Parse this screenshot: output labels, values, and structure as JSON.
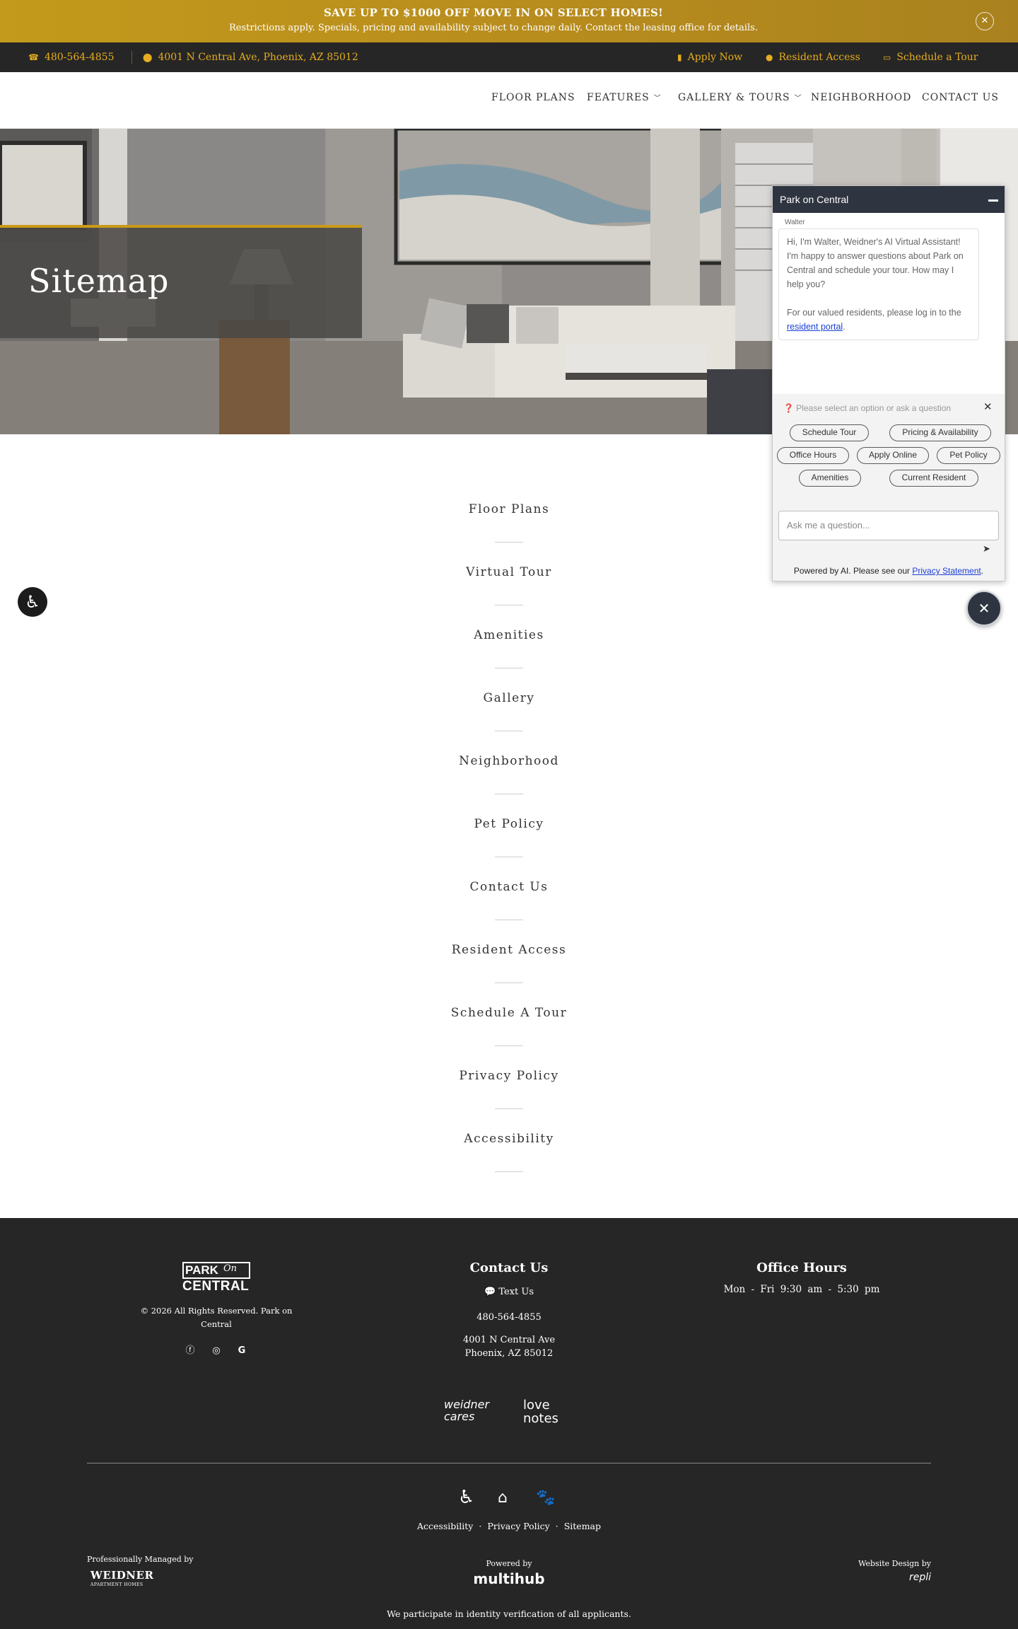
{
  "promo": {
    "headline": "SAVE UP TO $1000 OFF MOVE IN ON SELECT HOMES!",
    "subtext": "Restrictions apply. Specials, pricing and availability subject to change daily. Contact the leasing office for details.",
    "close_glyph": "✕"
  },
  "utility": {
    "phone": "480-564-4855",
    "address": "4001 N Central Ave, Phoenix, AZ 85012",
    "apply": "Apply Now",
    "resident": "Resident Access",
    "tour": "Schedule a Tour",
    "accent_color": "#e6ad1f"
  },
  "nav": {
    "items": [
      {
        "label": "FLOOR PLANS"
      },
      {
        "label": "FEATURES"
      },
      {
        "label": "GALLERY & TOURS"
      },
      {
        "label": "NEIGHBORHOOD"
      },
      {
        "label": "CONTACT US"
      }
    ]
  },
  "hero": {
    "title": "Sitemap",
    "accent_color": "#c99a18"
  },
  "sitemap": {
    "links": [
      "Floor Plans",
      "Virtual Tour",
      "Amenities",
      "Gallery",
      "Neighborhood",
      "Pet Policy",
      "Contact Us",
      "Resident Access",
      "Schedule A Tour",
      "Privacy Policy",
      "Accessibility"
    ]
  },
  "chat": {
    "title": "Park on Central",
    "sender": "Walter",
    "message_1": "Hi, I'm Walter, Weidner's AI Virtual Assistant! I'm happy to answer questions about Park on Central and schedule your tour. How may I help you?",
    "message_2_prefix": "For our valued residents, please log in to the ",
    "message_2_link": "resident portal",
    "message_2_suffix": ".",
    "prompt": "Please select an option or ask a question",
    "options": [
      "Schedule Tour",
      "Pricing & Availability",
      "Office Hours",
      "Apply Online",
      "Pet Policy",
      "Amenities",
      "Current Resident"
    ],
    "input_placeholder": "Ask me a question...",
    "powered_prefix": "Powered by AI. Please see our ",
    "powered_link": "Privacy Statement",
    "powered_suffix": ".",
    "header_color": "#2f3540"
  },
  "footer": {
    "logo_park": "PARK",
    "logo_on": "On",
    "logo_central": "CENTRAL",
    "copyright": "© 2026 All Rights Reserved. Park on Central",
    "contact_heading": "Contact Us",
    "text_us": "Text Us",
    "phone": "480-564-4855",
    "address_line1": "4001 N Central Ave",
    "address_line2": "Phoenix, AZ 85012",
    "hours_heading": "Office Hours",
    "hours": "Mon - Fri   9:30 am - 5:30 pm",
    "brand_cares": "weidner cares",
    "brand_notes": "love notes",
    "links": [
      "Accessibility",
      "Privacy Policy",
      "Sitemap"
    ],
    "managed_by": "Professionally Managed by",
    "managed_logo": "WEIDNER",
    "managed_sub": "APARTMENT HOMES",
    "powered_by": "Powered by",
    "powered_logo": "multihub",
    "design_by": "Website Design by",
    "design_logo": "repli",
    "verification": "We participate in identity verification of all applicants.",
    "background": "#262626"
  }
}
